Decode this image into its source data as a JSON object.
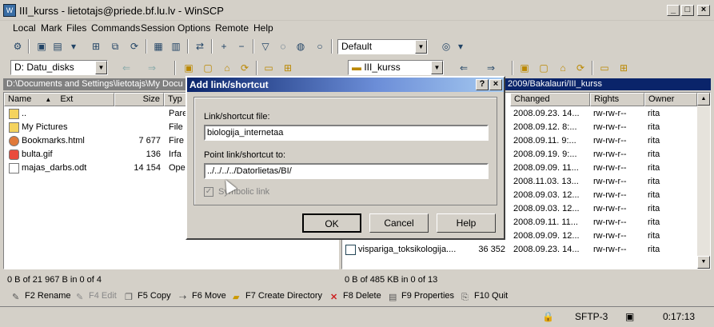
{
  "window": {
    "title": "III_kurss - lietotajs@priede.bf.lu.lv - WinSCP"
  },
  "menu": [
    "Local",
    "Mark",
    "Files",
    "Commands",
    "Session",
    "Options",
    "Remote",
    "Help"
  ],
  "toolbar": {
    "session_preset": "Default"
  },
  "left": {
    "drive": "D: Datu_disks",
    "path": "D:\\Documents and Settings\\lietotajs\\My Docu",
    "columns": [
      "Name",
      "Ext",
      "Size",
      "Typ"
    ],
    "rows": [
      {
        "name": "..",
        "size": "",
        "type": "Pare"
      },
      {
        "name": "My Pictures",
        "size": "",
        "type": "File"
      },
      {
        "name": "Bookmarks.html",
        "size": "7 677",
        "type": "Fire"
      },
      {
        "name": "bulta.gif",
        "size": "136",
        "type": "Irfa"
      },
      {
        "name": "majas_darbs.odt",
        "size": "14 154",
        "type": "Ope"
      }
    ],
    "status": "0 B of 21 967 B in 0 of 4"
  },
  "right": {
    "dir": "III_kurss",
    "path": "2009/Bakalauri/III_kurss",
    "columns": [
      "Changed",
      "Rights",
      "Owner"
    ],
    "rows": [
      {
        "changed": "2008.09.23. 14...",
        "rights": "rw-rw-r--",
        "owner": "rita"
      },
      {
        "changed": "2008.09.12. 8:...",
        "rights": "rw-rw-r--",
        "owner": "rita"
      },
      {
        "changed": "2008.09.11. 9:...",
        "rights": "rw-rw-r--",
        "owner": "rita"
      },
      {
        "changed": "2008.09.19. 9:...",
        "rights": "rw-rw-r--",
        "owner": "rita"
      },
      {
        "changed": "2008.09.09. 11...",
        "rights": "rw-rw-r--",
        "owner": "rita"
      },
      {
        "changed": "2008.11.03. 13...",
        "rights": "rw-rw-r--",
        "owner": "rita"
      },
      {
        "changed": "2008.09.03. 12...",
        "rights": "rw-rw-r--",
        "owner": "rita"
      },
      {
        "changed": "2008.09.03. 12...",
        "rights": "rw-rw-r--",
        "owner": "rita"
      },
      {
        "changed": "2008.09.11. 11...",
        "rights": "rw-rw-r--",
        "owner": "rita"
      },
      {
        "changed": "2008.09.09. 12...",
        "rights": "rw-rw-r--",
        "owner": "rita"
      },
      {
        "changed": "2008.09.23. 14...",
        "rights": "rw-rw-r--",
        "owner": "rita"
      }
    ],
    "last_file": {
      "name": "vispariga_toksikologija....",
      "size": "36 352"
    },
    "status": "0 B of 485 KB in 0 of 13"
  },
  "fkeys": [
    {
      "key": "F2",
      "label": "Rename"
    },
    {
      "key": "F4",
      "label": "Edit"
    },
    {
      "key": "F5",
      "label": "Copy"
    },
    {
      "key": "F6",
      "label": "Move"
    },
    {
      "key": "F7",
      "label": "Create Directory"
    },
    {
      "key": "F8",
      "label": "Delete"
    },
    {
      "key": "F9",
      "label": "Properties"
    },
    {
      "key": "F10",
      "label": "Quit"
    }
  ],
  "statusbar": {
    "protocol": "SFTP-3",
    "time": "0:17:13"
  },
  "dialog": {
    "title": "Add link/shortcut",
    "file_label": "Link/shortcut file:",
    "file_value": "biologija_internetaa",
    "target_label": "Point link/shortcut to:",
    "target_value": "../../../../Datorlietas/BI/",
    "symbolic_label": "Symbolic link",
    "ok": "OK",
    "cancel": "Cancel",
    "help": "Help"
  },
  "colors": {
    "accent": "#0a246a",
    "path_active": "#0a246a",
    "path_inactive": "#808080"
  }
}
